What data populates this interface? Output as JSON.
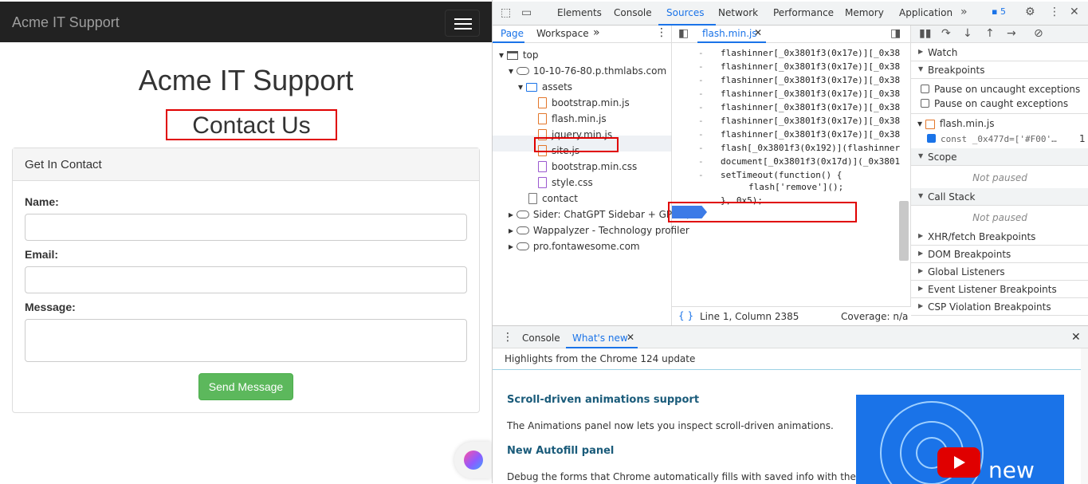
{
  "page": {
    "brand": "Acme IT Support",
    "title": "Acme IT Support",
    "subtitle": "Contact Us",
    "panel_heading": "Get In Contact",
    "name_label": "Name:",
    "email_label": "Email:",
    "message_label": "Message:",
    "send_button": "Send Message"
  },
  "devtools": {
    "tabs": [
      "Elements",
      "Console",
      "Sources",
      "Network",
      "Performance",
      "Memory",
      "Application"
    ],
    "active_tab": "Sources",
    "issues_count": "5",
    "nav_tabs": [
      "Page",
      "Workspace"
    ],
    "tree": {
      "top": "top",
      "domain": "10-10-76-80.p.thmlabs.com",
      "assets": "assets",
      "files": [
        "bootstrap.min.js",
        "flash.min.js",
        "jquery.min.js",
        "site.js",
        "bootstrap.min.css",
        "style.css"
      ],
      "contact": "contact",
      "ext1": "Sider: ChatGPT Sidebar + GPT-4,",
      "ext2": "Wappalyzer - Technology profiler",
      "ext3": "pro.fontawesome.com"
    },
    "editor_tab": "flash.min.js",
    "code_lines": [
      "flashinner[_0x3801f3(0x17e)][_0x38",
      "flashinner[_0x3801f3(0x17e)][_0x38",
      "flashinner[_0x3801f3(0x17e)][_0x38",
      "flashinner[_0x3801f3(0x17e)][_0x38",
      "flashinner[_0x3801f3(0x17e)][_0x38",
      "flashinner[_0x3801f3(0x17e)][_0x38",
      "flashinner[_0x3801f3(0x17e)][_0x38",
      "flash[_0x3801f3(0x192)](flashinner",
      "document[_0x3801f3(0x17d)](_0x3801",
      "setTimeout(function() {",
      "flash['remove']();",
      "}, 0x5);"
    ],
    "line2": "2",
    "status_position": "Line 1, Column 2385",
    "status_coverage": "Coverage: n/a",
    "sections": {
      "watch": "Watch",
      "breakpoints": "Breakpoints",
      "pause_uncaught": "Pause on uncaught exceptions",
      "pause_caught": "Pause on caught exceptions",
      "bp_file": "flash.min.js",
      "bp_code": "const _0x477d=['#F00'…",
      "bp_line": "1",
      "scope": "Scope",
      "not_paused_1": "Not paused",
      "call_stack": "Call Stack",
      "not_paused_2": "Not paused",
      "xhr": "XHR/fetch Breakpoints",
      "dom": "DOM Breakpoints",
      "global": "Global Listeners",
      "event": "Event Listener Breakpoints",
      "csp": "CSP Violation Breakpoints"
    },
    "drawer": {
      "tabs": [
        "Console",
        "What's new"
      ],
      "highlights": "Highlights from the Chrome 124 update",
      "h1": "Scroll-driven animations support",
      "p1": "The Animations panel now lets you inspect scroll-driven animations.",
      "h2": "New Autofill panel",
      "p2": "Debug the forms that Chrome automatically fills with saved info with the",
      "promo_text": "new"
    }
  },
  "colors": {
    "navbar": "#222222",
    "highlight_box": "#e00000",
    "send_button": "#5cb85c",
    "devtools_accent": "#1a73e8",
    "breakpoint": "#3c7be7"
  }
}
